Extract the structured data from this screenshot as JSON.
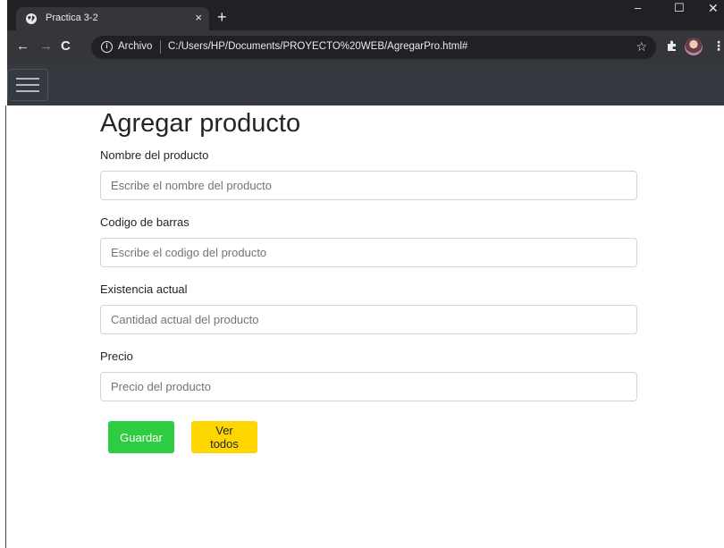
{
  "browser": {
    "tab_title": "Practica 3-2",
    "tab_close": "×",
    "new_tab": "+",
    "window_minimize": "–",
    "window_maximize": "☐",
    "window_close": "✕",
    "nav_back": "←",
    "nav_forward": "→",
    "nav_reload": "C",
    "info_glyph": "i",
    "url_scheme": "Archivo",
    "url": "C:/Users/HP/Documents/PROYECTO%20WEB/AgregarPro.html#",
    "bookmark_star": "☆",
    "menu": "⋮"
  },
  "page": {
    "heading": "Agregar producto",
    "fields": [
      {
        "label": "Nombre del producto",
        "placeholder": "Escribe el nombre del producto",
        "value": ""
      },
      {
        "label": "Codigo de barras",
        "placeholder": "Escribe el codigo del producto",
        "value": ""
      },
      {
        "label": "Existencia actual",
        "placeholder": "Cantidad actual del producto",
        "value": ""
      },
      {
        "label": "Precio",
        "placeholder": "Precio del producto",
        "value": ""
      }
    ],
    "buttons": {
      "save": "Guardar",
      "view_all": "Ver todos"
    }
  },
  "colors": {
    "navbar": "#343a40",
    "save_button": "#2ecc40",
    "view_all_button": "#ffd700"
  },
  "icons": {
    "tab_favicon": "globe-icon",
    "extensions": "puzzle-icon",
    "toggler": "hamburger-icon"
  }
}
